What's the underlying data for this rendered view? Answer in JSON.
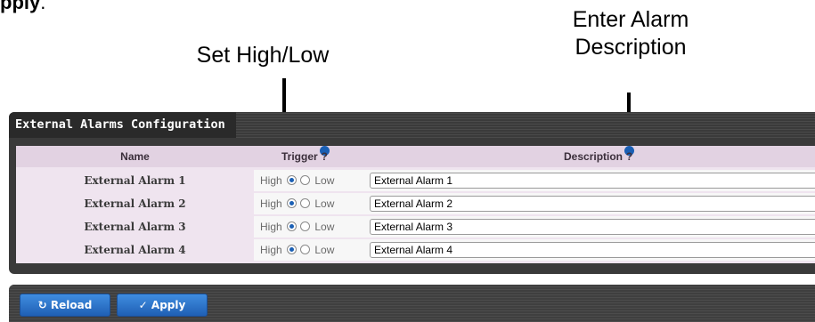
{
  "intro_bold": "pply",
  "intro_tail": ".",
  "callouts": {
    "left": "Set High/Low",
    "right_line1": "Enter Alarm",
    "right_line2": "Description"
  },
  "panel": {
    "title": "External Alarms Configuration",
    "headers": {
      "name": "Name",
      "trigger": "Trigger",
      "description": "Description"
    },
    "rows": [
      {
        "name": "External Alarm 1",
        "high": "High",
        "low": "Low",
        "selected": "high",
        "description": "External Alarm 1"
      },
      {
        "name": "External Alarm 2",
        "high": "High",
        "low": "Low",
        "selected": "high",
        "description": "External Alarm 2"
      },
      {
        "name": "External Alarm 3",
        "high": "High",
        "low": "Low",
        "selected": "high",
        "description": "External Alarm 3"
      },
      {
        "name": "External Alarm 4",
        "high": "High",
        "low": "Low",
        "selected": "high",
        "description": "External Alarm 4"
      }
    ]
  },
  "buttons": {
    "reload": "Reload",
    "apply": "Apply"
  },
  "icons": {
    "help": "help-icon",
    "reload": "reload-icon",
    "apply": "checkmark-icon"
  },
  "colors": {
    "accent": "#1f5fb4",
    "header_bg": "#e2d2e2",
    "row_bg": "#efe4ef"
  }
}
